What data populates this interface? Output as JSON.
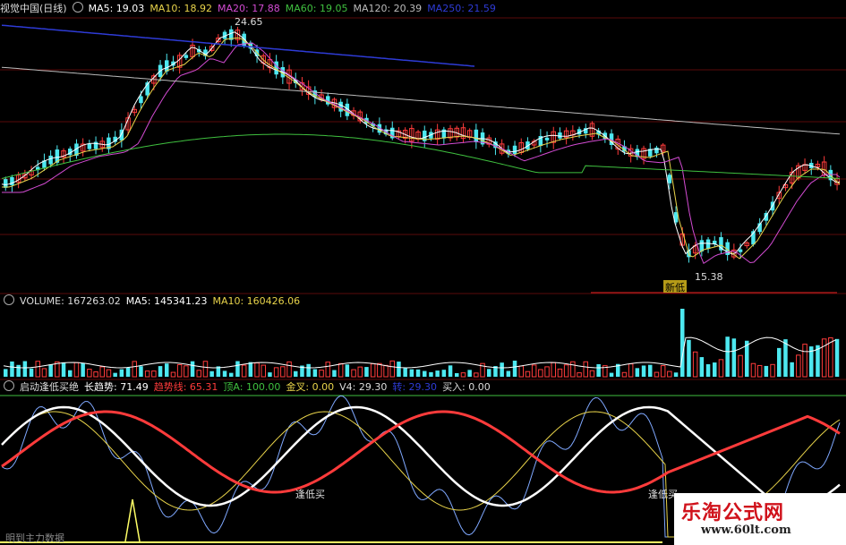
{
  "main_panel": {
    "title": "视觉中国(日线)",
    "ma5": "MA5: 19.03",
    "ma10": "MA10: 18.92",
    "ma20": "MA20: 17.88",
    "ma60": "MA60: 19.05",
    "ma120": "MA120: 20.39",
    "ma250": "MA250: 21.59",
    "high_label": "24.65",
    "low_label": "15.38",
    "new_low_tag": "新低"
  },
  "volume_panel": {
    "title": "VOLUME: 167263.02",
    "ma5": "MA5: 145341.23",
    "ma10": "MA10: 160426.06"
  },
  "indicator_panel": {
    "title": "启动逢低买绝",
    "long_trend": "长趋势: 71.49",
    "short_trend": "趋势线: 65.31",
    "top": "顶A: 100.00",
    "golden_cross": "金叉: 0.00",
    "v4": "V4: 29.30",
    "hidden": "转: 29.30",
    "buy": "买入: 0.00",
    "note1": "逢低买",
    "note2": "逢低买",
    "bottom_text": "明到主力数据"
  },
  "watermark": {
    "title": "乐淘公式网",
    "url": "www.60lt.com"
  },
  "colors": {
    "up": "#ff3b3b",
    "down": "#4de8f0",
    "ma5": "#ffffff",
    "ma10": "#e8d34a",
    "ma20": "#d24bd2",
    "ma60": "#3fc03f",
    "ma120": "#bbbbbb",
    "ma250": "#2e3bd6"
  }
}
